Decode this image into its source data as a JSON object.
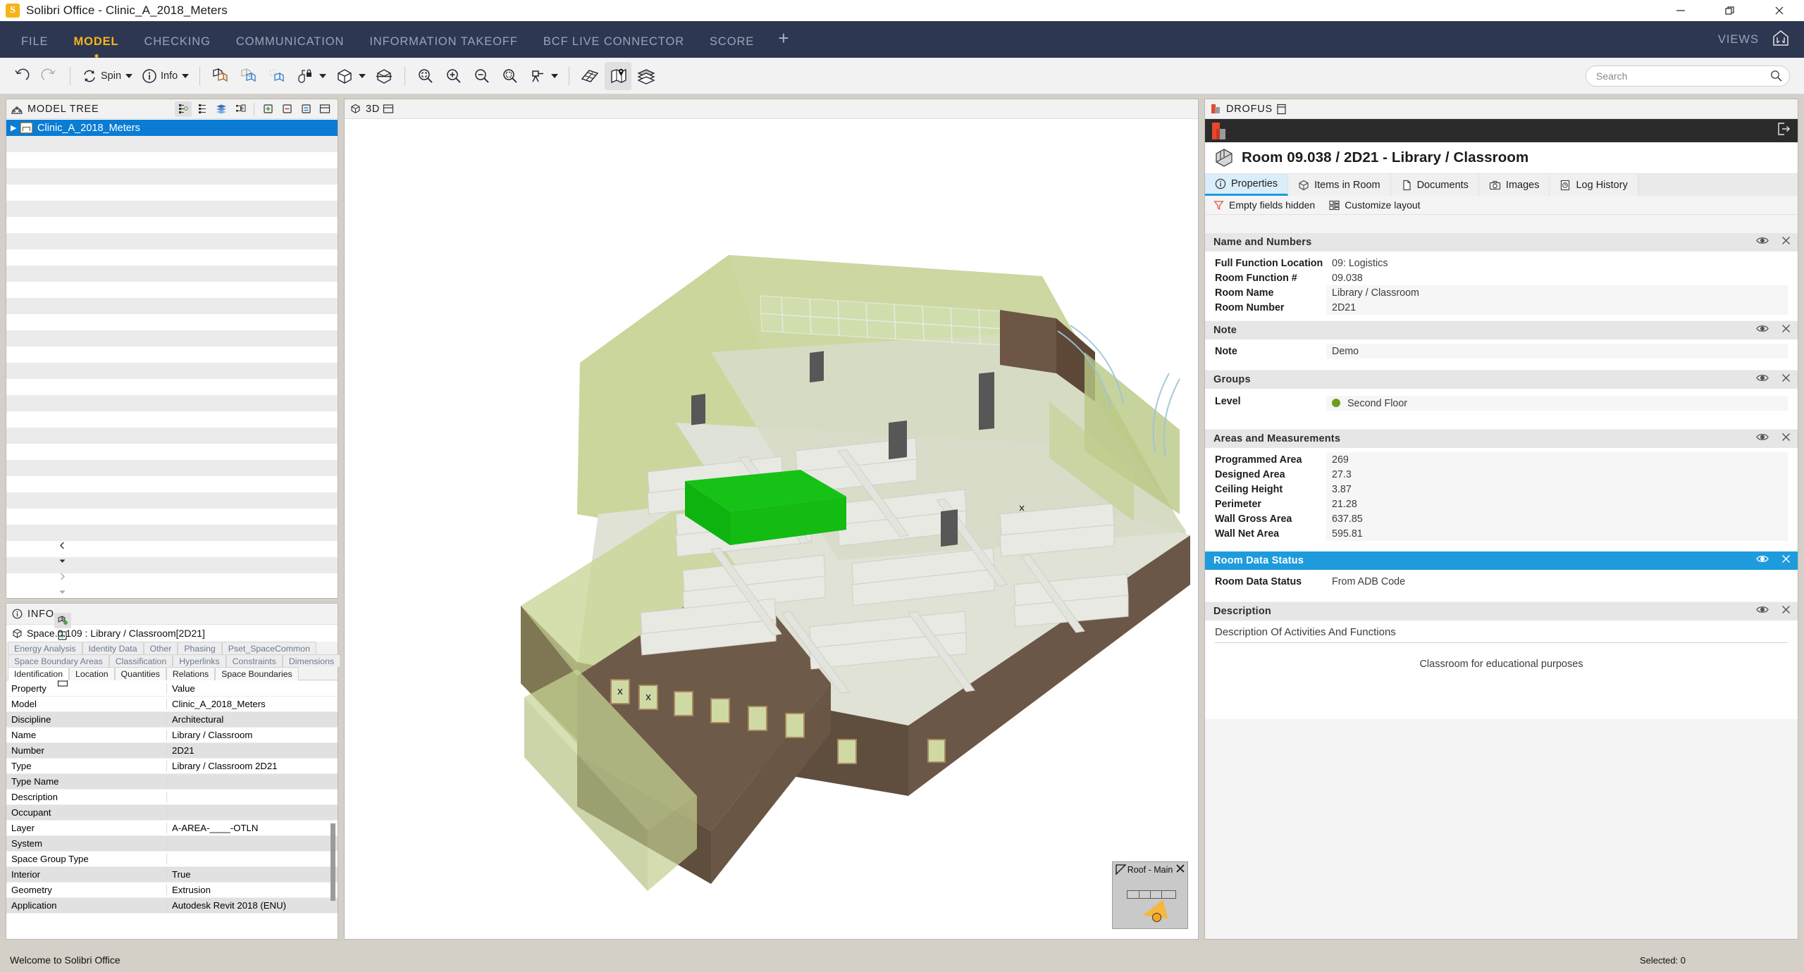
{
  "window": {
    "title": "Solibri Office - Clinic_A_2018_Meters",
    "logo_letter": "S",
    "minimize_label": "Minimize",
    "restore_label": "Restore",
    "close_label": "Close"
  },
  "menubar": {
    "items": [
      {
        "label": "FILE",
        "active": false
      },
      {
        "label": "MODEL",
        "active": true
      },
      {
        "label": "CHECKING",
        "active": false
      },
      {
        "label": "COMMUNICATION",
        "active": false
      },
      {
        "label": "INFORMATION TAKEOFF",
        "active": false
      },
      {
        "label": "BCF LIVE CONNECTOR",
        "active": false
      },
      {
        "label": "SCORE",
        "active": false
      }
    ],
    "add_tab": "+",
    "views_label": "VIEWS"
  },
  "toolbar": {
    "undo": "Undo",
    "redo": "Redo",
    "spin_label": "Spin",
    "info_label": "Info",
    "buttons": [
      "show-hide-components",
      "transparent-components",
      "hide-components",
      "paint-lock",
      "show-all",
      "section-box",
      "zoom-fit",
      "zoom-in",
      "zoom-out",
      "zoom-area",
      "walk",
      "slab-view",
      "map-view",
      "layers"
    ]
  },
  "search": {
    "placeholder": "Search",
    "value": ""
  },
  "model_tree": {
    "title": "MODEL TREE",
    "header_buttons": [
      "tree-hierarchy",
      "tree-flat",
      "tree-layers",
      "tree-federated",
      "expand-all",
      "collapse-all",
      "details",
      "split-view"
    ],
    "nodes": [
      {
        "label": "Clinic_A_2018_Meters",
        "selected": true,
        "expanded": false
      }
    ]
  },
  "info_panel": {
    "title": "INFO",
    "subject": "Space.0.109 : Library / Classroom[2D21]",
    "nav_prev": "Previous",
    "nav_next": "Next",
    "header_buttons": [
      "components",
      "expand-all",
      "collapse-all",
      "details",
      "split-view"
    ],
    "tabs_row1": [
      "Energy Analysis",
      "Identity Data",
      "Other",
      "Phasing",
      "Pset_SpaceCommon"
    ],
    "tabs_row2": [
      "Space Boundary Areas",
      "Classification",
      "Hyperlinks",
      "Constraints",
      "Dimensions"
    ],
    "tabs_row3": [
      "Identification",
      "Location",
      "Quantities",
      "Relations",
      "Space Boundaries"
    ],
    "active_tab": "Identification",
    "columns": [
      "Property",
      "Value"
    ],
    "rows": [
      {
        "property": "Model",
        "value": "Clinic_A_2018_Meters"
      },
      {
        "property": "Discipline",
        "value": "Architectural"
      },
      {
        "property": "Name",
        "value": "Library / Classroom"
      },
      {
        "property": "Number",
        "value": "2D21"
      },
      {
        "property": "Type",
        "value": "Library / Classroom 2D21"
      },
      {
        "property": "Type Name",
        "value": ""
      },
      {
        "property": "Description",
        "value": ""
      },
      {
        "property": "Occupant",
        "value": ""
      },
      {
        "property": "Layer",
        "value": "A-AREA-____-OTLN"
      },
      {
        "property": "System",
        "value": ""
      },
      {
        "property": "Space Group Type",
        "value": ""
      },
      {
        "property": "Interior",
        "value": "True"
      },
      {
        "property": "Geometry",
        "value": "Extrusion"
      },
      {
        "property": "Application",
        "value": "Autodesk Revit 2018 (ENU)"
      }
    ]
  },
  "view3d": {
    "title": "3D",
    "nav_widget": {
      "label": "Roof - Main",
      "close_label": "Close"
    }
  },
  "drofus": {
    "panel_title": "DROFUS",
    "room_title": "Room 09.038 / 2D21 - Library / Classroom",
    "tabs": [
      {
        "label": "Properties",
        "icon": "info-icon",
        "active": true
      },
      {
        "label": "Items in Room",
        "icon": "cube-icon",
        "active": false
      },
      {
        "label": "Documents",
        "icon": "document-icon",
        "active": false
      },
      {
        "label": "Images",
        "icon": "camera-icon",
        "active": false
      },
      {
        "label": "Log History",
        "icon": "history-icon",
        "active": false
      }
    ],
    "actions": [
      {
        "label": "Empty fields hidden",
        "icon": "filter-icon"
      },
      {
        "label": "Customize layout",
        "icon": "layout-icon"
      }
    ],
    "accent_color": "#1e9bdc",
    "sections": [
      {
        "title": "Name and Numbers",
        "highlighted": false,
        "fields": [
          {
            "key": "Full Function Location",
            "value": "09: Logistics",
            "boxed": false
          },
          {
            "key": "Room Function #",
            "value": "09.038",
            "boxed": false
          },
          {
            "key": "Room Name",
            "value": "Library / Classroom",
            "boxed": true
          },
          {
            "key": "Room Number",
            "value": "2D21",
            "boxed": true
          }
        ]
      },
      {
        "title": "Note",
        "highlighted": false,
        "fields": [
          {
            "key": "Note",
            "value": "Demo",
            "boxed": true
          }
        ]
      },
      {
        "title": "Groups",
        "highlighted": false,
        "fields": [
          {
            "key": "Level",
            "value": "Second Floor",
            "boxed": true,
            "dot_color": "#6d9e1f"
          }
        ]
      },
      {
        "title": "Areas and Measurements",
        "highlighted": false,
        "fields": [
          {
            "key": "Programmed Area",
            "value": "269",
            "boxed": true
          },
          {
            "key": "Designed Area",
            "value": "27.3",
            "boxed": true
          },
          {
            "key": "Ceiling Height",
            "value": "3.87",
            "boxed": true
          },
          {
            "key": "Perimeter",
            "value": "21.28",
            "boxed": true
          },
          {
            "key": "Wall Gross Area",
            "value": "637.85",
            "boxed": true
          },
          {
            "key": "Wall Net Area",
            "value": "595.81",
            "boxed": true
          }
        ]
      },
      {
        "title": "Room Data Status",
        "highlighted": true,
        "fields": [
          {
            "key": "Room Data Status",
            "value": "From ADB Code",
            "boxed": false
          }
        ]
      }
    ],
    "description_section": {
      "title": "Description",
      "label": "Description Of Activities And Functions",
      "text": "Classroom for educational purposes"
    }
  },
  "statusbar": {
    "message": "Welcome to Solibri Office",
    "selection": "Selected: 0"
  }
}
